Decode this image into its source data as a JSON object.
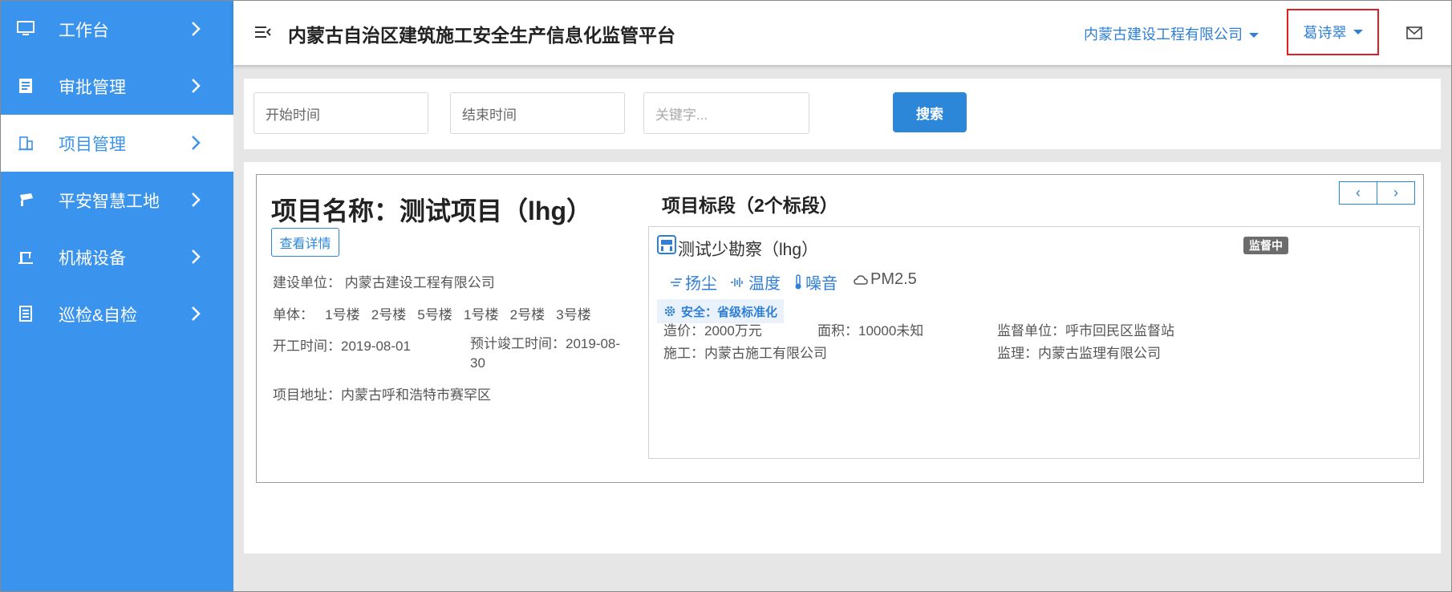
{
  "sidebar": {
    "items": [
      {
        "label": "工作台",
        "icon": "monitor-icon"
      },
      {
        "label": "审批管理",
        "icon": "document-icon"
      },
      {
        "label": "项目管理",
        "icon": "building-icon",
        "active": true
      },
      {
        "label": "平安智慧工地",
        "icon": "camera-icon"
      },
      {
        "label": "机械设备",
        "icon": "crane-icon"
      },
      {
        "label": "巡检&自检",
        "icon": "checklist-icon"
      }
    ]
  },
  "header": {
    "title": "内蒙古自治区建筑施工安全生产信息化监管平台",
    "company": "内蒙古建设工程有限公司",
    "user": "葛诗翠"
  },
  "search": {
    "start_placeholder": "开始时间",
    "end_placeholder": "结束时间",
    "keyword_placeholder": "关键字...",
    "button_label": "搜索"
  },
  "project": {
    "title": "项目名称：测试项目（lhg）",
    "detail_button": "查看详情",
    "builder": "建设单位： 内蒙古建设工程有限公司",
    "units": "单体：   1号楼   2号楼   5号楼   1号楼   2号楼   3号楼",
    "start_time": "开工时间：2019-08-01",
    "expected_finish": "预计竣工时间：2019-08-30",
    "address": "项目地址：内蒙古呼和浩特市赛罕区"
  },
  "segments": {
    "title": "项目标段（2个标段）",
    "prev": "‹",
    "next": "›",
    "current": {
      "name": "测试少勘察（lhg）",
      "status": "监督中",
      "sensors": [
        "扬尘",
        "温度",
        "噪音",
        "PM2.5"
      ],
      "safety": "安全：省级标准化",
      "cost": "造价：2000万元",
      "area": "面积：10000未知",
      "supervision": "监督单位：呼市回民区监督站",
      "construction": "施工：内蒙古施工有限公司",
      "supervisor": "监理：内蒙古监理有限公司"
    }
  },
  "colors": {
    "sidebar": "#3a93ec",
    "accent": "#2c87d8",
    "highlight_border": "#e02020"
  }
}
